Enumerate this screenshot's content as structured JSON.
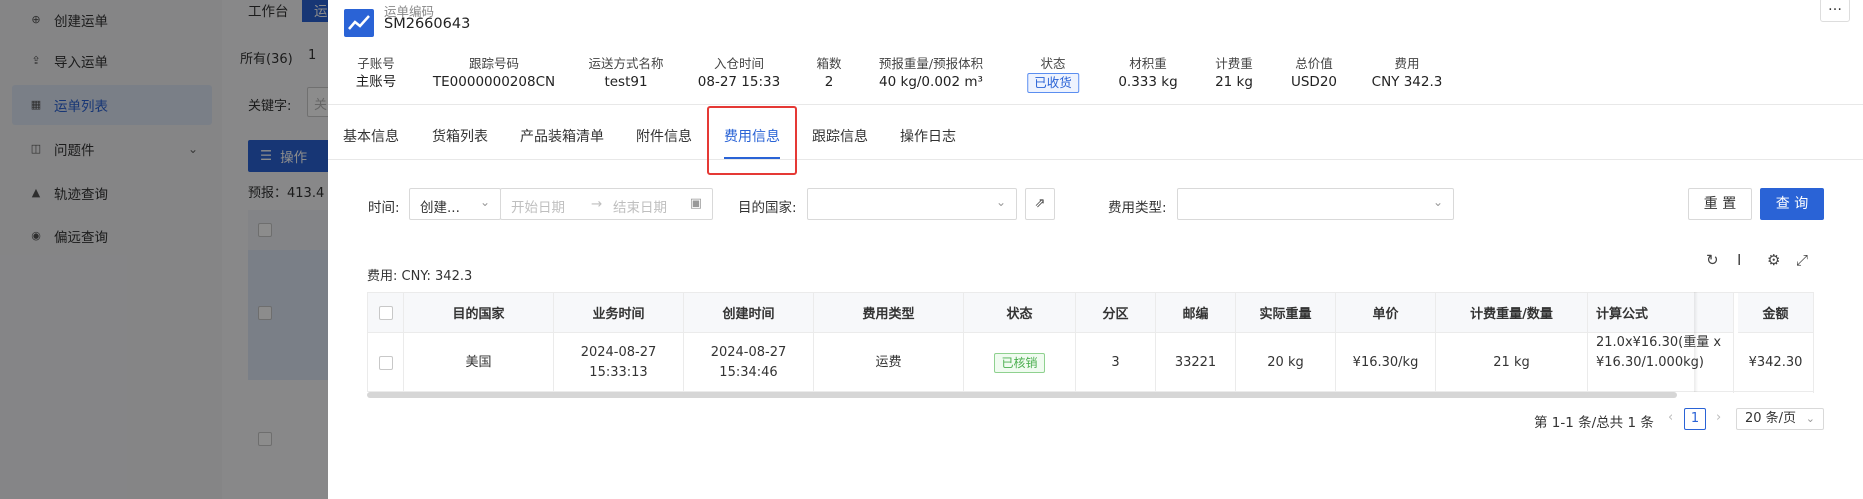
{
  "sidebar": {
    "items": [
      {
        "label": "创建运单",
        "icon": "create-icon"
      },
      {
        "label": "导入运单",
        "icon": "upload-icon"
      },
      {
        "label": "运单列表",
        "icon": "list-icon"
      },
      {
        "label": "问题件",
        "icon": "issue-icon"
      },
      {
        "label": "轨迹查询",
        "icon": "track-icon"
      },
      {
        "label": "偏远查询",
        "icon": "remote-icon"
      }
    ]
  },
  "background": {
    "tab_workbench": "工作台",
    "tab_active_partial": "运",
    "seg_all": "所有(36)",
    "seg_partial": "1",
    "keyword_label": "关键字:",
    "keyword_placeholder_partial": "关",
    "op_button": "操作",
    "prereport_partial": "预报：413.4"
  },
  "drawer": {
    "code_label": "运单编码",
    "code_value": "SM2660643",
    "info": [
      {
        "label": "子账号",
        "value": "主账号"
      },
      {
        "label": "跟踪号码",
        "value": "TE0000000208CN"
      },
      {
        "label": "运送方式名称",
        "value": "test91"
      },
      {
        "label": "入仓时间",
        "value": "08-27 15:33"
      },
      {
        "label": "箱数",
        "value": "2"
      },
      {
        "label": "预报重量/预报体积",
        "value": "40 kg/0.002 m³"
      },
      {
        "label": "状态",
        "value": "已收货"
      },
      {
        "label": "材积重",
        "value": "0.333 kg"
      },
      {
        "label": "计费重",
        "value": "21 kg"
      },
      {
        "label": "总价值",
        "value": "USD20"
      },
      {
        "label": "费用",
        "value": "CNY 342.3"
      }
    ],
    "tabs": [
      "基本信息",
      "货箱列表",
      "产品装箱清单",
      "附件信息",
      "费用信息",
      "跟踪信息",
      "操作日志"
    ],
    "active_tab": "费用信息",
    "filters": {
      "time_label": "时间:",
      "time_type": "创建...",
      "start_placeholder": "开始日期",
      "arrow": "→",
      "end_placeholder": "结束日期",
      "country_label": "目的国家:",
      "fee_type_label": "费用类型:",
      "reset": "重 置",
      "query": "查 询"
    },
    "fee_summary": "费用: CNY: 342.3",
    "table": {
      "headers": [
        "目的国家",
        "业务时间",
        "创建时间",
        "费用类型",
        "状态",
        "分区",
        "邮编",
        "实际重量",
        "单价",
        "计费重量/数量",
        "计算公式",
        "金额"
      ],
      "rows": [
        {
          "country": "美国",
          "biz_date": "2024-08-27",
          "biz_time": "15:33:13",
          "create_date": "2024-08-27",
          "create_time": "15:34:46",
          "fee_type": "运费",
          "status": "已核销",
          "zone": "3",
          "zip": "33221",
          "actual_weight": "20 kg",
          "unit_price": "¥16.30/kg",
          "billed_weight": "21 kg",
          "formula_line1": "21.0x¥16.30(重量 x",
          "formula_line2": "¥16.30/1.000kg)",
          "amount": "¥342.30"
        }
      ]
    },
    "pagination": {
      "total": "第 1-1 条/总共 1 条",
      "current": "1",
      "page_size": "20 条/页"
    }
  },
  "colors": {
    "primary": "#2a63d6",
    "highlight_border": "#e53935",
    "success": "#4caf50"
  }
}
